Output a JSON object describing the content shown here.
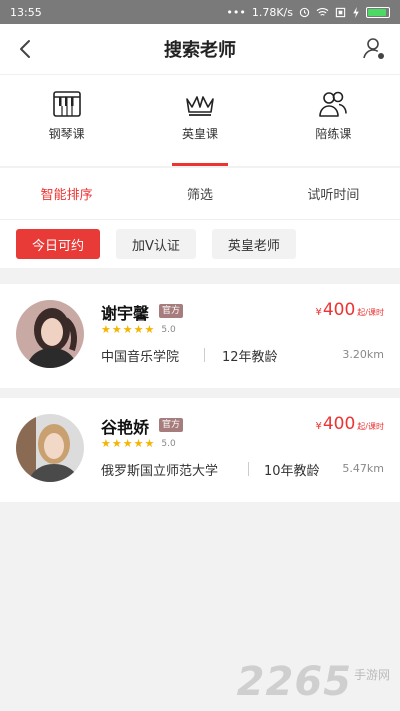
{
  "status": {
    "time": "13:55",
    "dots": "•••",
    "speed": "1.78K/s",
    "battery_level": 0.9
  },
  "nav": {
    "title": "搜索老师"
  },
  "categories": [
    {
      "label": "钢琴课",
      "icon": "piano-icon",
      "active": false
    },
    {
      "label": "英皇课",
      "icon": "crown-icon",
      "active": true
    },
    {
      "label": "陪练课",
      "icon": "people-icon",
      "active": false
    }
  ],
  "sort": [
    "智能排序",
    "筛选",
    "试听时间"
  ],
  "tags": [
    "今日可约",
    "加V认证",
    "英皇老师"
  ],
  "teachers": [
    {
      "name": "谢宇馨",
      "badge": "官方",
      "rating": "5.0",
      "school": "中国音乐学院",
      "years": "12年教龄",
      "currency": "¥",
      "price": "400",
      "unit": "起/课时",
      "distance": "3.20km"
    },
    {
      "name": "谷艳娇",
      "badge": "官方",
      "rating": "5.0",
      "school": "俄罗斯国立师范大学",
      "years": "10年教龄",
      "currency": "¥",
      "price": "400",
      "unit": "起/课时",
      "distance": "5.47km"
    }
  ],
  "watermark": {
    "big": "2265",
    "small": "手游网"
  },
  "colors": {
    "accent": "#e83a36",
    "star": "#f4b400"
  }
}
